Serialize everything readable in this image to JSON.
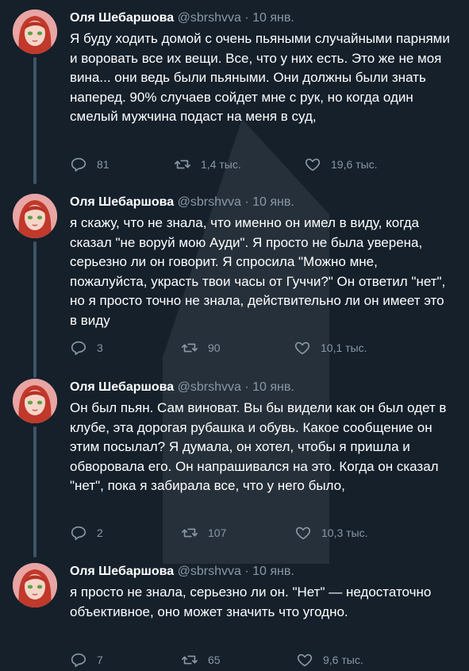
{
  "user": {
    "name": "Оля Шебаршова",
    "handle": "@sbrshvva",
    "separator": "·"
  },
  "tweets": [
    {
      "date": "10 янв.",
      "text": "Я буду ходить домой с очень пьяными случайными парнями и воровать все их вещи. Все, что у них есть. Это же не моя вина... они ведь были пьяными. Они должны были знать наперед. 90% случаев сойдет мне с рук, но когда один смелый мужчина подаст на меня в суд,",
      "replies": "81",
      "retweets": "1,4 тыс.",
      "likes": "19,6 тыс."
    },
    {
      "date": "10 янв.",
      "text": "я скажу, что не знала, что именно он имел в виду, когда сказал \"не воруй мою Ауди\". Я просто не была уверена, серьезно ли он говорит. Я спросила \"Можно мне, пожалуйста, украсть твои часы от Гуччи?\" Он ответил \"нет\", но я просто точно не знала, действительно ли он имеет это в виду",
      "replies": "3",
      "retweets": "90",
      "likes": "10,1 тыс."
    },
    {
      "date": "10 янв.",
      "text": "Он был пьян. Сам виноват. Вы бы видели как он был одет в клубе, эта дорогая рубашка и обувь. Какое сообщение он этим посылал? Я думала, он хотел, чтобы я пришла и обворовала его. Он напрашивался на это. Когда он сказал \"нет\", пока я забирала все, что у него было,",
      "replies": "2",
      "retweets": "107",
      "likes": "10,3 тыс."
    },
    {
      "date": "10 янв.",
      "text": "я просто не знала, серьезно ли он. \"Нет\" — недостаточно объективное, оно может значить что угодно.",
      "replies": "7",
      "retweets": "65",
      "likes": "9,6 тыс."
    }
  ],
  "icons": {
    "reply": "reply-icon",
    "retweet": "retweet-icon",
    "like": "like-icon"
  },
  "colors": {
    "background": "#15202b",
    "text": "#ffffff",
    "muted": "#8899a6",
    "thread_line": "#3d5466"
  }
}
